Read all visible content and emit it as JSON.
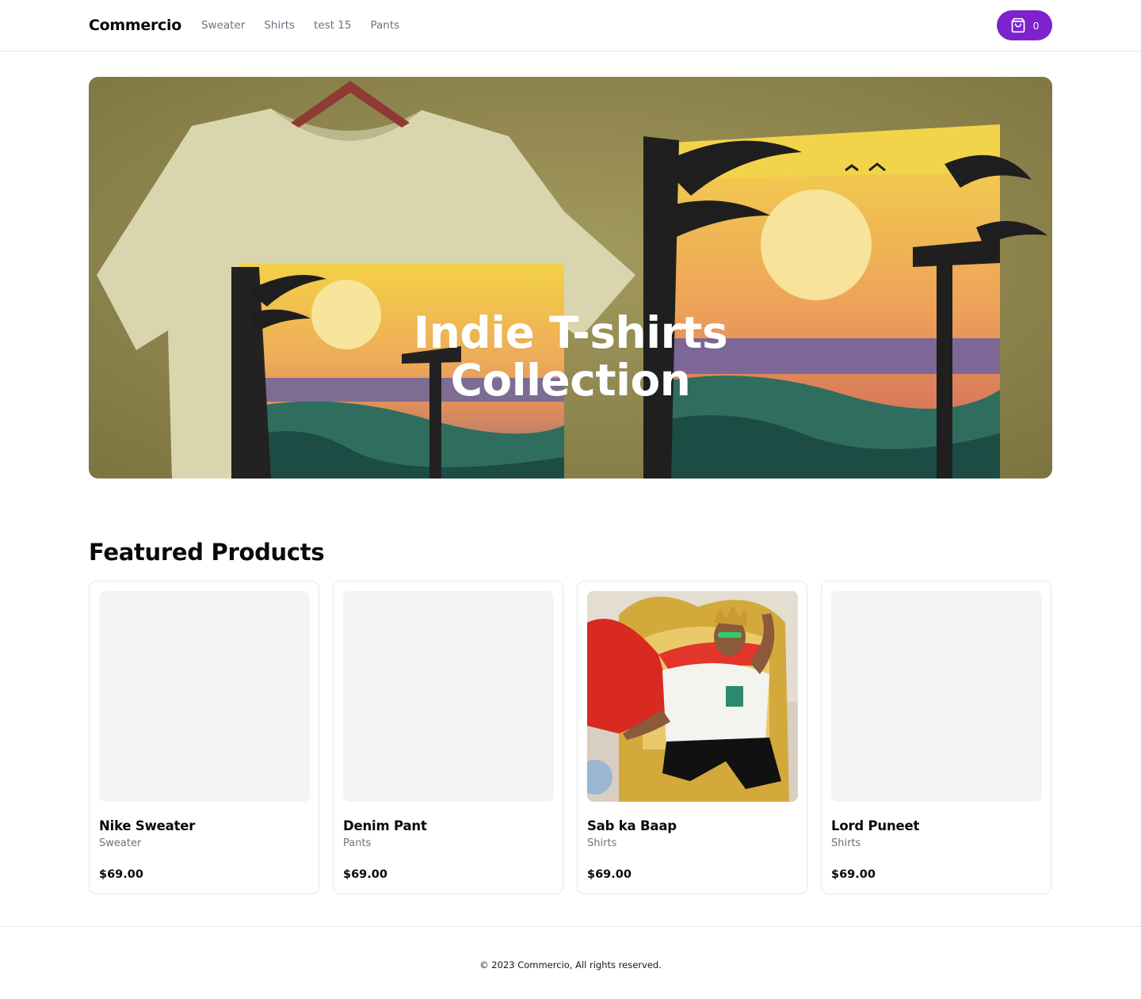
{
  "header": {
    "logo": "Commercio",
    "nav": [
      "Sweater",
      "Shirts",
      "test 15",
      "Pants"
    ],
    "cart_count": "0",
    "cart_icon": "shopping-bag-icon",
    "accent_color": "#7e22ce"
  },
  "hero": {
    "title_line1": "Indie T-shirts",
    "title_line2": "Collection"
  },
  "featured": {
    "title": "Featured Products",
    "products": [
      {
        "name": "Nike Sweater",
        "category": "Sweater",
        "price": "$69.00"
      },
      {
        "name": "Denim Pant",
        "category": "Pants",
        "price": "$69.00"
      },
      {
        "name": "Sab ka Baap",
        "category": "Shirts",
        "price": "$69.00"
      },
      {
        "name": "Lord Puneet",
        "category": "Shirts",
        "price": "$69.00"
      }
    ]
  },
  "footer": {
    "text": "© 2023 Commercio, All rights reserved."
  }
}
